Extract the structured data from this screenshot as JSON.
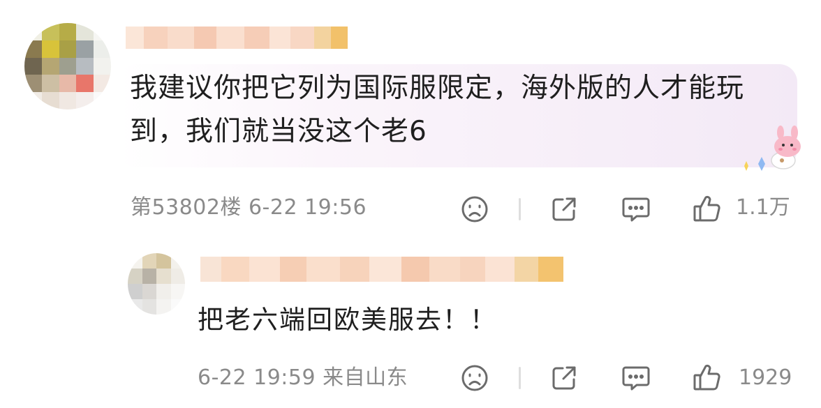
{
  "comment": {
    "text": "我建议你把它列为国际服限定，海外版的人才能玩到，我们就当没这个老6",
    "floor_time": "第53802楼 6-22 19:56",
    "likes": "1.1万"
  },
  "reply": {
    "text": "把老六端回欧美服去！！",
    "meta": "6-22 19:59 来自山东",
    "likes": "1929"
  },
  "icons": [
    "avatar-blurred",
    "sad-face-icon",
    "share-icon",
    "comment-icon",
    "thumbs-up-icon",
    "bunny-sticker"
  ],
  "colors": {
    "bubble_end": "#f3e9f6",
    "meta_text": "#8a8a8a",
    "icon_stroke": "#6b6b6b"
  }
}
